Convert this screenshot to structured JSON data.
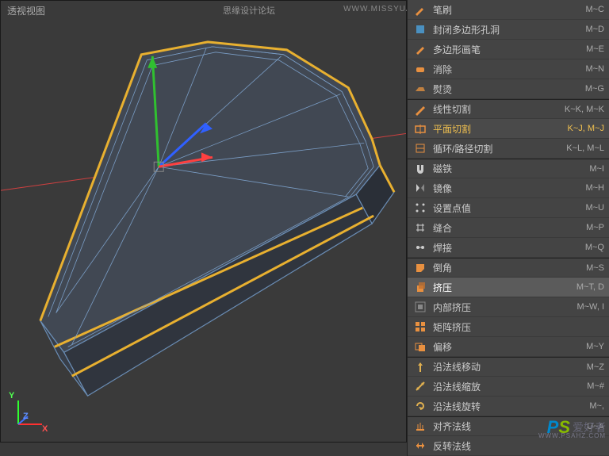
{
  "viewport": {
    "label": "透视视图"
  },
  "watermark_top": "WWW.MISSYUAN.COM",
  "watermark_cn": "思缘设计论坛",
  "watermark_bottom": {
    "ps": "PS",
    "text": "爱好者",
    "url": "WWW.PSAHZ.COM"
  },
  "axis": {
    "x": "X",
    "y": "Y",
    "z": "Z"
  },
  "menu": [
    {
      "icon": "brush",
      "iconColor": "#e89040",
      "label": "笔刷",
      "shortcut": "M~C",
      "sep": false
    },
    {
      "icon": "poly",
      "iconColor": "#4a90c0",
      "label": "封闭多边形孔洞",
      "shortcut": "M~D",
      "sep": false
    },
    {
      "icon": "pen",
      "iconColor": "#e89040",
      "label": "多边形画笔",
      "shortcut": "M~E",
      "sep": false
    },
    {
      "icon": "erase",
      "iconColor": "#e89040",
      "label": "消除",
      "shortcut": "M~N",
      "sep": false
    },
    {
      "icon": "iron",
      "iconColor": "#c08040",
      "label": "熨烫",
      "shortcut": "M~G",
      "sep": false
    },
    {
      "icon": "knife",
      "iconColor": "#e89040",
      "label": "线性切割",
      "shortcut": "K~K, M~K",
      "sep": true
    },
    {
      "icon": "plane",
      "iconColor": "#e89040",
      "label": "平面切割",
      "shortcut": "K~J, M~J",
      "sep": false,
      "highlight2": true
    },
    {
      "icon": "loop",
      "iconColor": "#e89040",
      "label": "循环/路径切割",
      "shortcut": "K~L, M~L",
      "sep": false
    },
    {
      "icon": "magnet",
      "iconColor": "#ccc",
      "label": "磁铁",
      "shortcut": "M~I",
      "sep": true
    },
    {
      "icon": "mirror",
      "iconColor": "#ccc",
      "label": "镜像",
      "shortcut": "M~H",
      "sep": false
    },
    {
      "icon": "points",
      "iconColor": "#ccc",
      "label": "设置点值",
      "shortcut": "M~U",
      "sep": false
    },
    {
      "icon": "stitch",
      "iconColor": "#ccc",
      "label": "缝合",
      "shortcut": "M~P",
      "sep": false
    },
    {
      "icon": "weld",
      "iconColor": "#ccc",
      "label": "焊接",
      "shortcut": "M~Q",
      "sep": false
    },
    {
      "icon": "bevel",
      "iconColor": "#e89040",
      "label": "倒角",
      "shortcut": "M~S",
      "sep": true
    },
    {
      "icon": "extrude",
      "iconColor": "#e89040",
      "label": "挤压",
      "shortcut": "M~T, D",
      "sep": false,
      "highlight": true
    },
    {
      "icon": "inner",
      "iconColor": "#888",
      "label": "内部挤压",
      "shortcut": "M~W, I",
      "sep": false
    },
    {
      "icon": "matrix",
      "iconColor": "#e89040",
      "label": "矩阵挤压",
      "shortcut": "",
      "sep": false
    },
    {
      "icon": "offset",
      "iconColor": "#e89040",
      "label": "偏移",
      "shortcut": "M~Y",
      "sep": false
    },
    {
      "icon": "nmove",
      "iconColor": "#e0b050",
      "label": "沿法线移动",
      "shortcut": "M~Z",
      "sep": true
    },
    {
      "icon": "nscale",
      "iconColor": "#e0b050",
      "label": "沿法线缩放",
      "shortcut": "M~#",
      "sep": false
    },
    {
      "icon": "nrot",
      "iconColor": "#e0b050",
      "label": "沿法线旋转",
      "shortcut": "M~,",
      "sep": false
    },
    {
      "icon": "align",
      "iconColor": "#e89040",
      "label": "对齐法线",
      "shortcut": "U~A",
      "sep": true
    },
    {
      "icon": "flip",
      "iconColor": "#e89040",
      "label": "反转法线",
      "shortcut": "",
      "sep": false
    }
  ]
}
